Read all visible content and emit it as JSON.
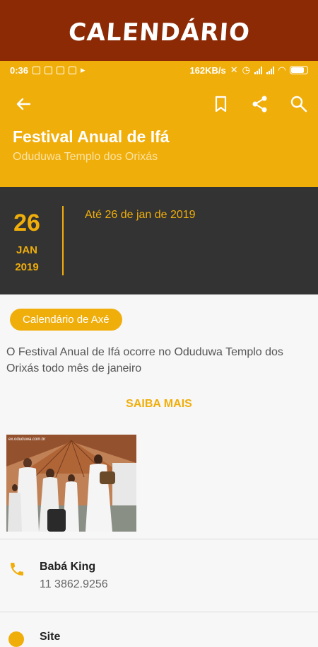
{
  "banner": {
    "title": "CALENDÁRIO"
  },
  "status_bar": {
    "time": "0:36",
    "network_speed": "162KB/s"
  },
  "app_bar": {
    "back_icon": "arrow-back-icon",
    "actions": [
      "bookmark-icon",
      "share-icon",
      "search-icon"
    ]
  },
  "event": {
    "title": "Festival Anual de Ifá",
    "subtitle": "Oduduwa Templo dos Orixás",
    "date_day": "26",
    "date_month": "JAN",
    "date_year": "2019",
    "until_text": "Até 26 de jan de 2019",
    "category": "Calendário de Axé",
    "description": "O Festival Anual de Ifá ocorre no Oduduwa Templo dos Orixás todo mês de janeiro",
    "more_label": "SAIBA MAIS",
    "photo_watermark": "ex.oduduwa.com.br"
  },
  "contact": {
    "name": "Babá King",
    "phone": "11 3862.9256"
  },
  "site": {
    "label": "Site"
  },
  "colors": {
    "banner": "#8b2a05",
    "accent": "#f0ae0b",
    "dark": "#333333",
    "background": "#f7f7f7"
  }
}
